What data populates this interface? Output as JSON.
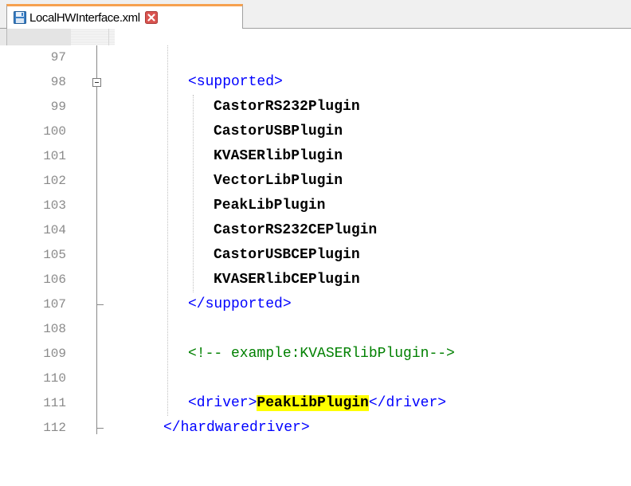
{
  "tab": {
    "filename": "LocalHWInterface.xml",
    "accent_color": "#f6a14f",
    "save_icon": "floppy-disk-icon",
    "close_icon": "close-icon"
  },
  "editor": {
    "lines": [
      {
        "num": "97",
        "segments": []
      },
      {
        "num": "98",
        "segments": [
          {
            "t": "tag",
            "v": "<supported>"
          }
        ]
      },
      {
        "num": "99",
        "segments": [
          {
            "t": "txt",
            "v": "CastorRS232Plugin"
          }
        ]
      },
      {
        "num": "100",
        "segments": [
          {
            "t": "txt",
            "v": "CastorUSBPlugin"
          }
        ]
      },
      {
        "num": "101",
        "segments": [
          {
            "t": "txt",
            "v": "KVASERlibPlugin"
          }
        ]
      },
      {
        "num": "102",
        "segments": [
          {
            "t": "txt",
            "v": "VectorLibPlugin"
          }
        ]
      },
      {
        "num": "103",
        "segments": [
          {
            "t": "txt",
            "v": "PeakLibPlugin"
          }
        ]
      },
      {
        "num": "104",
        "segments": [
          {
            "t": "txt",
            "v": "CastorRS232CEPlugin"
          }
        ]
      },
      {
        "num": "105",
        "segments": [
          {
            "t": "txt",
            "v": "CastorUSBCEPlugin"
          }
        ]
      },
      {
        "num": "106",
        "segments": [
          {
            "t": "txt",
            "v": "KVASERlibCEPlugin"
          }
        ]
      },
      {
        "num": "107",
        "segments": [
          {
            "t": "tag",
            "v": "</supported>"
          }
        ]
      },
      {
        "num": "108",
        "segments": []
      },
      {
        "num": "109",
        "segments": [
          {
            "t": "cmt",
            "v": "<!-- example:KVASERlibPlugin-->"
          }
        ]
      },
      {
        "num": "110",
        "segments": []
      },
      {
        "num": "111",
        "segments": [
          {
            "t": "tag",
            "v": "<driver>"
          },
          {
            "t": "hl",
            "v": "PeakLibPlugin"
          },
          {
            "t": "tag",
            "v": "</driver>"
          }
        ]
      },
      {
        "num": "112",
        "segments": [
          {
            "t": "tag",
            "v": "</hardwaredriver>"
          }
        ]
      }
    ],
    "highlight_color": "#ffff00",
    "tag_color": "#0000ff",
    "comment_color": "#008000"
  }
}
